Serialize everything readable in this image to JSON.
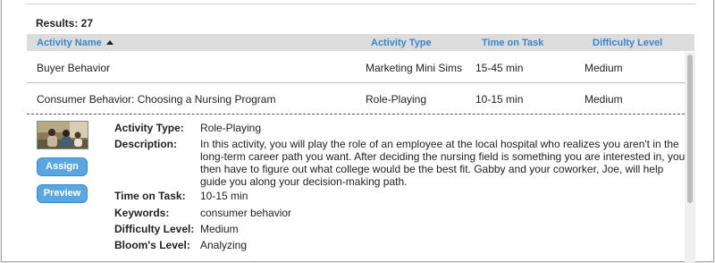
{
  "results": {
    "label": "Results: 27"
  },
  "table": {
    "headers": [
      {
        "label": "Activity Name"
      },
      {
        "label": "Activity Type"
      },
      {
        "label": "Time on Task"
      },
      {
        "label": "Difficulty Level"
      }
    ],
    "rows": [
      {
        "name": "Buyer Behavior",
        "type": "Marketing Mini Sims",
        "time": "15-45 min",
        "difficulty": "Medium"
      },
      {
        "name": "Consumer Behavior: Choosing a Nursing Program",
        "type": "Role-Playing",
        "time": "10-15 min",
        "difficulty": "Medium"
      }
    ]
  },
  "detail": {
    "assign_label": "Assign",
    "preview_label": "Preview",
    "fields": {
      "activity_type": {
        "label": "Activity Type:",
        "value": "Role-Playing"
      },
      "description": {
        "label": "Description:",
        "value": "In this activity, you will play the role of an employee at the local hospital who realizes you aren't in the long-term career path you want. After deciding the nursing field is something you are interested in, you then have to figure out what college would be the best fit. Gabby and your coworker, Joe, will help guide you along your decision-making path."
      },
      "time_on_task": {
        "label": "Time on Task:",
        "value": "10-15 min"
      },
      "keywords": {
        "label": "Keywords:",
        "value": "consumer behavior"
      },
      "difficulty": {
        "label": "Difficulty Level:",
        "value": "Medium"
      },
      "blooms": {
        "label": "Bloom's Level:",
        "value": "Analyzing"
      }
    }
  },
  "colors": {
    "accent": "#3a86c8",
    "button": "#5aa6e0",
    "header_bg": "#dcdcdc"
  },
  "icons": {
    "sort": "sort-ascending-icon",
    "thumbnail": "activity-thumbnail"
  }
}
